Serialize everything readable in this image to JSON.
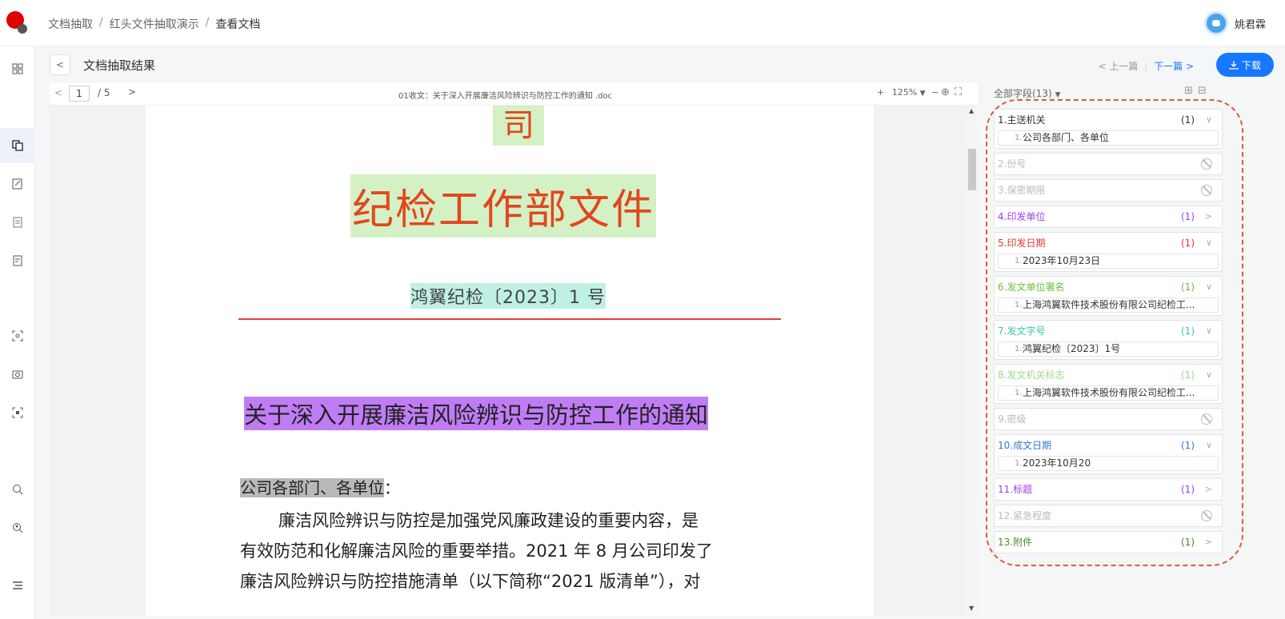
{
  "breadcrumb": [
    "文档抽取",
    "红头文件抽取演示",
    "查看文档"
  ],
  "user": {
    "name": "姚君霖"
  },
  "result": {
    "title": "文档抽取结果",
    "prev_label": "< 上一篇",
    "next_label": "下一篇 >",
    "download_label": "下载"
  },
  "viewer": {
    "page_current": "1",
    "page_total": "/ 5",
    "doc_name": "01收文：关于深入开展廉洁风险辨识与防控工作的通知 .doc",
    "zoom": "125%"
  },
  "document": {
    "top_fragment": "司",
    "header": "纪检工作部文件",
    "doc_number": "鸿翼纪检〔2023〕1 号",
    "title": "关于深入开展廉洁风险辨识与防控工作的通知",
    "salutation_hl": "公司各部门、各单位",
    "salutation_colon": "：",
    "body_lines": [
      "廉洁风险辨识与防控是加强党风廉政建设的重要内容，是",
      "有效防范和化解廉洁风险的重要举措。2021 年 8 月公司印发了",
      "廉洁风险辨识与防控措施清单（以下简称“2021 版清单”），对"
    ]
  },
  "panel": {
    "header": "全部字段(13)",
    "fields": [
      {
        "label": "1.主送机关",
        "count": "(1)",
        "color": "#333333",
        "state": "expanded",
        "value_index": "1.",
        "value": "公司各部门、各单位"
      },
      {
        "label": "2.份号",
        "count": "",
        "color": "#bbbbbb",
        "state": "empty",
        "value_index": "",
        "value": ""
      },
      {
        "label": "3.保密期限",
        "count": "",
        "color": "#bbbbbb",
        "state": "empty",
        "value_index": "",
        "value": ""
      },
      {
        "label": "4.印发单位",
        "count": "(1)",
        "color": "#9b3ff2",
        "state": "collapsed",
        "value_index": "",
        "value": ""
      },
      {
        "label": "5.印发日期",
        "count": "(1)",
        "color": "#e0342f",
        "state": "expanded",
        "value_index": "1.",
        "value": "2023年10月23日"
      },
      {
        "label": "6.发文单位署名",
        "count": "(1)",
        "color": "#6bbf3a",
        "state": "expanded",
        "value_index": "1.",
        "value": "上海鸿翼软件技术股份有限公司纪检工..."
      },
      {
        "label": "7.发文字号",
        "count": "(1)",
        "color": "#34c9a6",
        "state": "expanded",
        "value_index": "1.",
        "value": "鸿翼纪检〔2023〕1号"
      },
      {
        "label": "8.发文机关标志",
        "count": "(1)",
        "color": "#9fd88a",
        "state": "expanded",
        "value_index": "1.",
        "value": "上海鸿翼软件技术股份有限公司纪检工..."
      },
      {
        "label": "9.密级",
        "count": "",
        "color": "#bbbbbb",
        "state": "empty",
        "value_index": "",
        "value": ""
      },
      {
        "label": "10.成文日期",
        "count": "(1)",
        "color": "#2f7bd9",
        "state": "expanded",
        "value_index": "1.",
        "value": "2023年10月20"
      },
      {
        "label": "11.标题",
        "count": "(1)",
        "color": "#9b3ff2",
        "state": "collapsed",
        "value_index": "",
        "value": ""
      },
      {
        "label": "12.紧急程度",
        "count": "",
        "color": "#bbbbbb",
        "state": "empty",
        "value_index": "",
        "value": ""
      },
      {
        "label": "13.附件",
        "count": "(1)",
        "color": "#4d8a1f",
        "state": "collapsed",
        "value_index": "",
        "value": ""
      }
    ]
  },
  "colors": {
    "accent": "#1677ff",
    "red_header": "#e2471e",
    "dashed_outline": "#e05a3a"
  },
  "icons": [
    "logo-icon",
    "apps-icon",
    "doc-compare-icon",
    "doc-edit-icon",
    "doc-scan-icon",
    "doc-list-icon",
    "scan-frame-icon",
    "camera-icon",
    "capture-icon",
    "zoom-search-icon",
    "search-person-icon",
    "menu-icon",
    "download-icon",
    "user-avatar-icon",
    "expand-all-icon",
    "collapse-all-icon",
    "fit-icon",
    "fullscreen-icon"
  ]
}
